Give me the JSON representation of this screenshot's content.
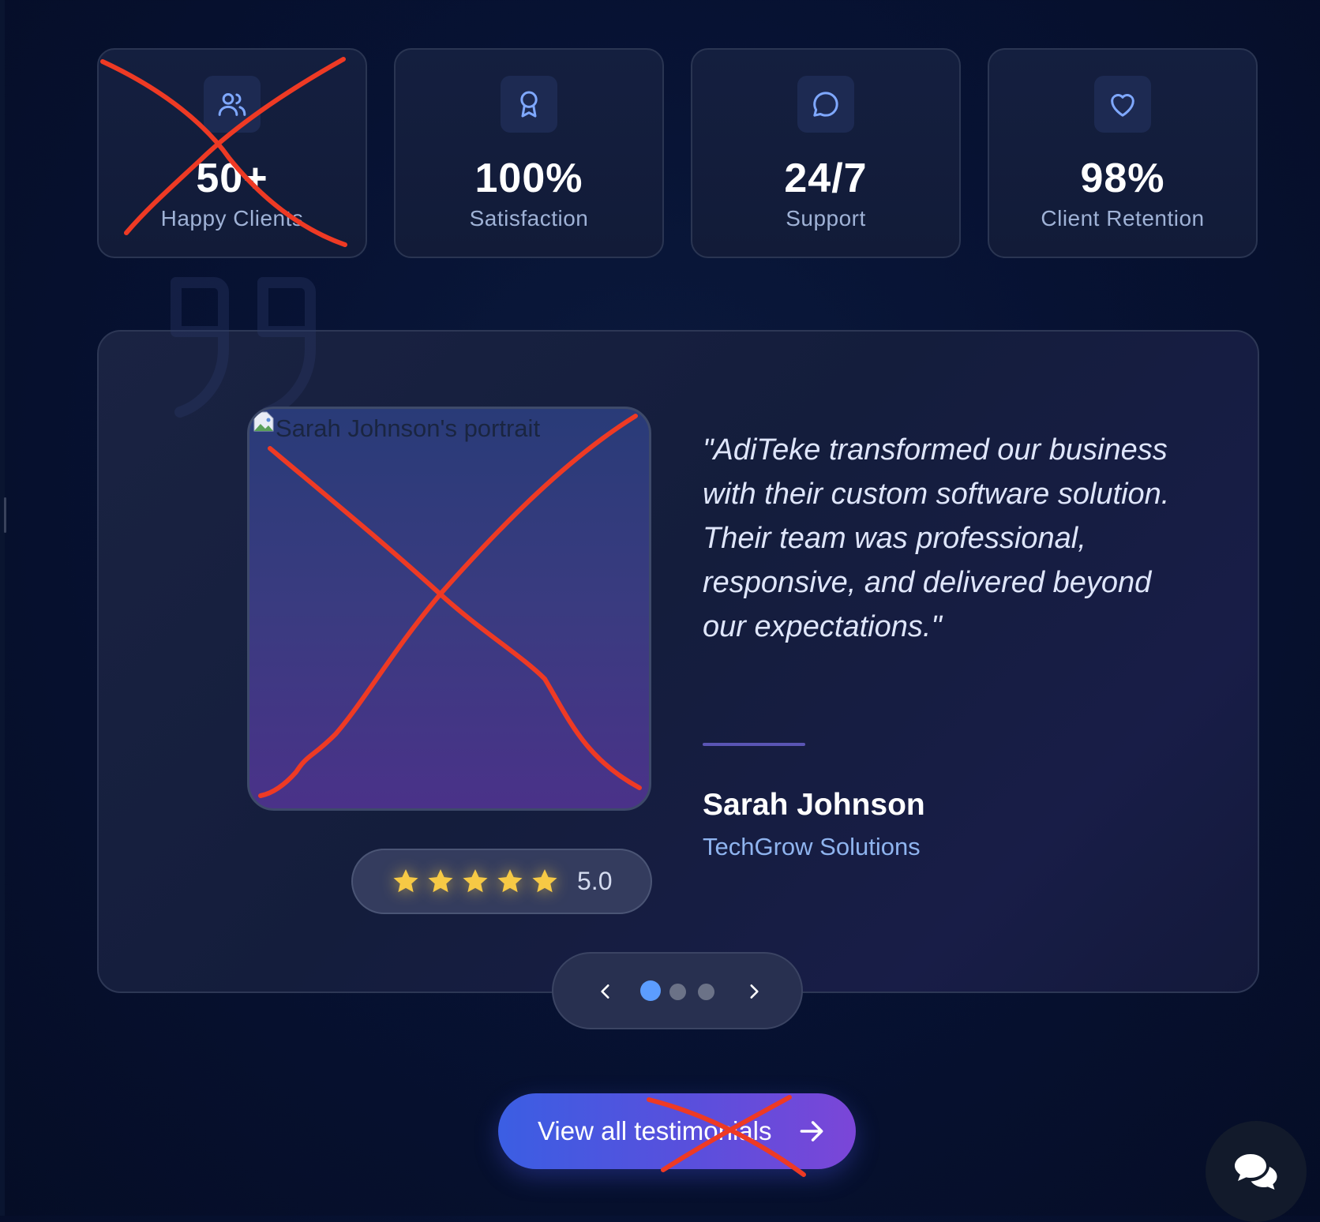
{
  "stats": [
    {
      "icon": "users-icon",
      "value": "50+",
      "label": "Happy Clients"
    },
    {
      "icon": "award-icon",
      "value": "100%",
      "label": "Satisfaction"
    },
    {
      "icon": "message-circle-icon",
      "value": "24/7",
      "label": "Support"
    },
    {
      "icon": "heart-icon",
      "value": "98%",
      "label": "Client Retention"
    }
  ],
  "testimonial": {
    "portrait_alt": "Sarah Johnson's portrait",
    "rating_value": "5.0",
    "stars": 5,
    "quote": "\"AdiTeke transformed our business with their custom software solution. Their team was professional, responsive, and delivered beyond our expectations.\"",
    "author_name": "Sarah Johnson",
    "author_company": "TechGrow Solutions"
  },
  "carousel": {
    "slides": 3,
    "active_index": 0
  },
  "cta": {
    "label": "View all testimonials"
  },
  "colors": {
    "accent": "#5c9dff",
    "star": "#f6c945",
    "annotation": "#ee3a24",
    "cta_start": "#3b5ee3",
    "cta_end": "#7b46d8"
  }
}
